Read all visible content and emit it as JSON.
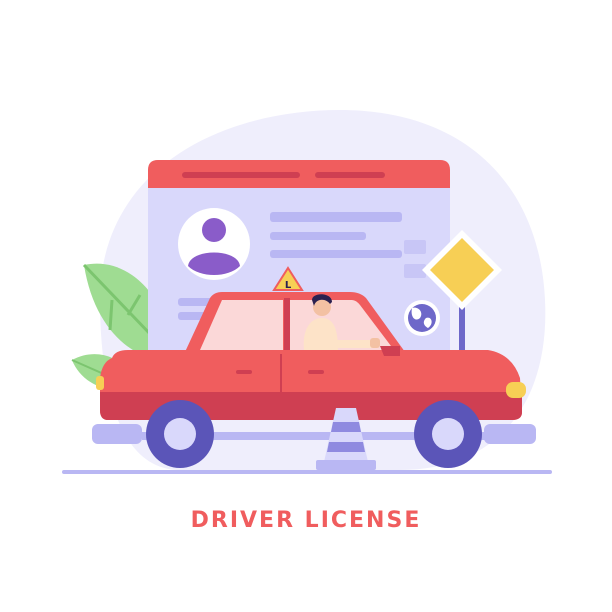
{
  "caption": "DRIVER LICENSE",
  "learner_sign_letter": "L",
  "colors": {
    "car_body": "#f05d5e",
    "car_body_dark": "#cf3f52",
    "card_header": "#f05d5e",
    "card_body": "#d9d8fb",
    "card_lines": "#b9b7f3",
    "blob_background": "#efeefc",
    "avatar_purple": "#8a5cc9",
    "wheel_purple": "#5b55b8",
    "road_sign_yellow": "#f7cf55",
    "leaf_green": "#9fdc92",
    "caption": "#f05d5e"
  },
  "icons": [
    "license-card",
    "avatar-icon",
    "globe-icon",
    "road-sign",
    "learner-sign",
    "leaf-plant",
    "traffic-cone",
    "car",
    "driver"
  ]
}
